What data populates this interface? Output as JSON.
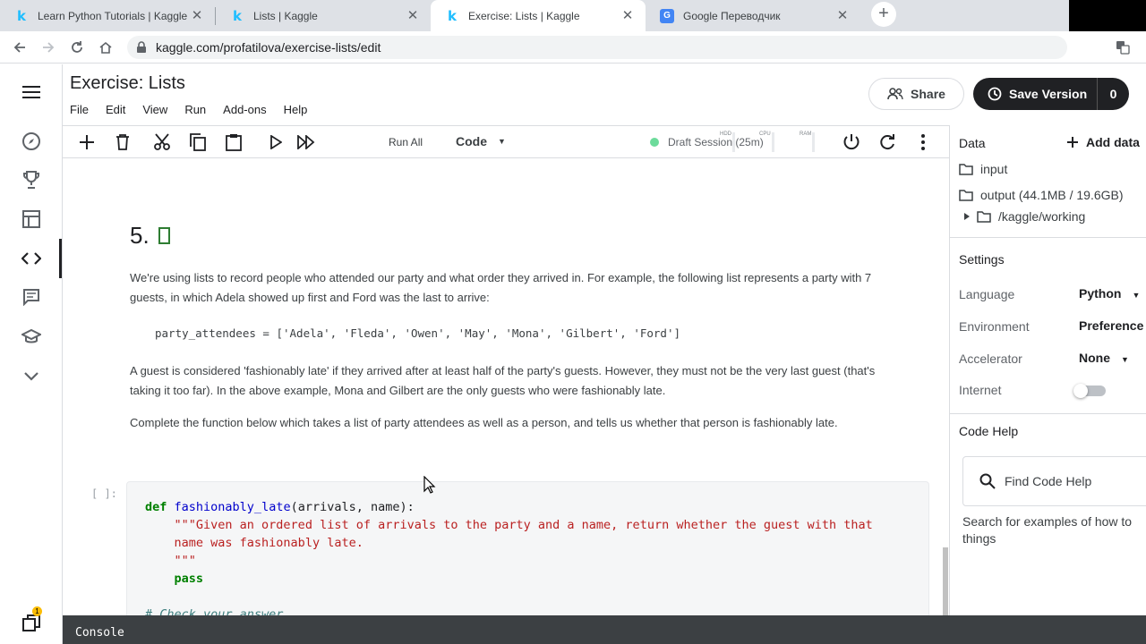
{
  "browser": {
    "tabs": [
      {
        "title": "Learn Python Tutorials | Kaggle",
        "icon": "kaggle-icon"
      },
      {
        "title": "Lists | Kaggle",
        "icon": "kaggle-icon"
      },
      {
        "title": "Exercise: Lists | Kaggle",
        "icon": "kaggle-icon",
        "active": true
      },
      {
        "title": "Google Переводчик",
        "icon": "google-translate-icon"
      }
    ],
    "url": "kaggle.com/profatilova/exercise-lists/edit"
  },
  "notebook": {
    "title": "Exercise: Lists",
    "menu": [
      "File",
      "Edit",
      "View",
      "Run",
      "Add-ons",
      "Help"
    ],
    "share_label": "Share",
    "save_label": "Save Version",
    "save_count": "0",
    "run_all_label": "Run All",
    "cell_type": "Code",
    "session": "Draft Session (25m)",
    "meters": [
      "HDD",
      "CPU",
      "RAM"
    ]
  },
  "content": {
    "heading_number": "5.",
    "para1": "We're using lists to record people who attended our party and what order they arrived in. For example, the following list represents a party with 7 guests, in which Adela showed up first and Ford was the last to arrive:",
    "code_example": "party_attendees = ['Adela', 'Fleda', 'Owen', 'May', 'Mona', 'Gilbert', 'Ford']",
    "para2": "A guest is considered 'fashionably late' if they arrived after at least half of the party's guests. However, they must not be the very last guest (that's taking it too far). In the above example, Mona and Gilbert are the only guests who were fashionably late.",
    "para3": "Complete the function below which takes a list of party attendees as well as a person, and tells us whether that person is fashionably late.",
    "cell_prompt": "[ ]:",
    "cell": {
      "kw_def": "def",
      "fn_name": "fashionably_late",
      "signature": "(arrivals, name):",
      "doc1": "\"\"\"Given an ordered list of arrivals to the party and a name, return whether the guest with that",
      "doc2": "name was fashionably late.",
      "doc3": "\"\"\"",
      "kw_pass": "pass",
      "comment": "# Check your answer"
    }
  },
  "right_panel": {
    "data_label": "Data",
    "add_data_label": "Add data",
    "input_label": "input",
    "output_label": "output (44.1MB / 19.6GB)",
    "working_label": "/kaggle/working",
    "settings_label": "Settings",
    "settings": [
      {
        "label": "Language",
        "value": "Python"
      },
      {
        "label": "Environment",
        "value": "Preference"
      },
      {
        "label": "Accelerator",
        "value": "None"
      },
      {
        "label": "Internet",
        "value": ""
      }
    ],
    "code_help_label": "Code Help",
    "find_code_help": "Find Code Help",
    "help_text": "Search for examples of how to things"
  },
  "rail": {
    "notification_count": "1"
  },
  "console_label": "Console",
  "colors": {
    "accent": "#20beff",
    "dark": "#202124",
    "session_green": "#2ecc71"
  }
}
